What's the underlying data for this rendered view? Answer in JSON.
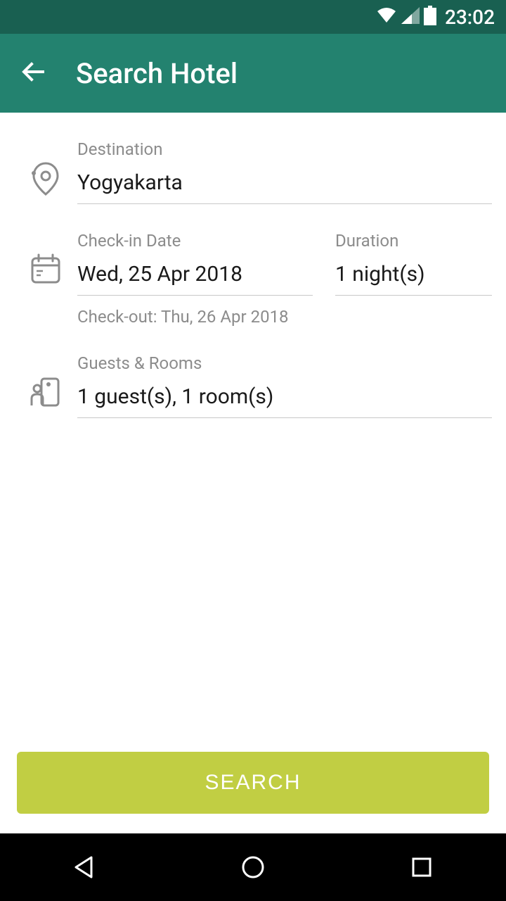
{
  "statusBar": {
    "time": "23:02"
  },
  "appBar": {
    "title": "Search Hotel"
  },
  "form": {
    "destination": {
      "label": "Destination",
      "value": "Yogyakarta"
    },
    "checkin": {
      "label": "Check-in Date",
      "value": "Wed, 25 Apr 2018"
    },
    "duration": {
      "label": "Duration",
      "value": "1 night(s)"
    },
    "checkoutNote": "Check-out: Thu, 26 Apr 2018",
    "guests": {
      "label": "Guests & Rooms",
      "value": "1 guest(s), 1 room(s)"
    }
  },
  "searchButton": "SEARCH"
}
